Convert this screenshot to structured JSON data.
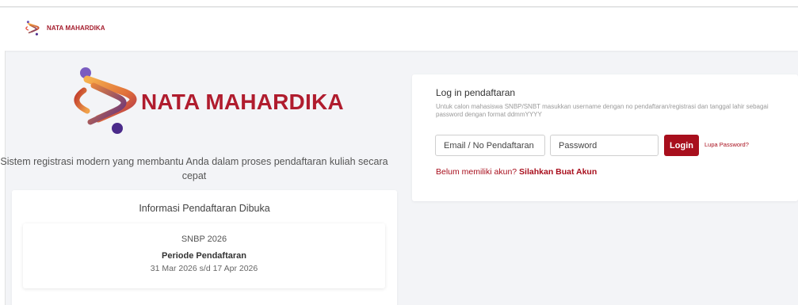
{
  "navbar": {
    "brand": "NATA MAHARDIKA",
    "logo_icon": "nata-mahardika-logo-icon"
  },
  "hero": {
    "title": "NATA MAHARDIKA",
    "description": "Sistem registrasi modern yang membantu Anda dalam proses pendaftaran kuliah secara cepat"
  },
  "info": {
    "title": "Informasi Pendaftaran Dibuka",
    "period": {
      "name": "SNBP 2026",
      "label": "Periode Pendaftaran",
      "dates": "31 Mar 2026 s/d 17 Apr 2026"
    }
  },
  "login": {
    "title": "Log in pendaftaran",
    "hint": "Untuk calon mahasiswa SNBP/SNBT masukkan username dengan no pendaftaran/registrasi dan tanggal lahir sebagai password dengan format ddmmYYYY",
    "email_placeholder": "Email / No Pendaftaran",
    "password_placeholder": "Password",
    "button_label": "Login",
    "forgot_label": "Lupa Password?",
    "no_account_text": "Belum memiliki akun?",
    "register_label": "Silahkan Buat Akun"
  },
  "colors": {
    "brand_red": "#a80f1d",
    "logo_orange": "#f0a14a",
    "logo_purple": "#4a2a8a"
  }
}
